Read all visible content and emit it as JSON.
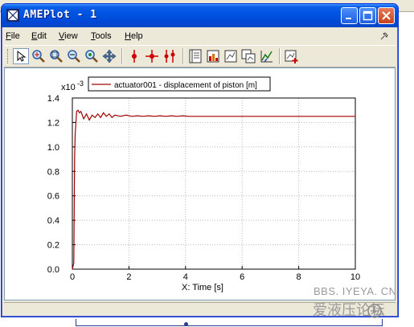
{
  "window": {
    "title": "AMEPlot - 1"
  },
  "menu": [
    {
      "lead": "F",
      "rest": "ile"
    },
    {
      "lead": "E",
      "rest": "dit"
    },
    {
      "lead": "V",
      "rest": "iew"
    },
    {
      "lead": "T",
      "rest": "ools"
    },
    {
      "lead": "H",
      "rest": "elp"
    }
  ],
  "toolbar": {
    "tools": [
      "select-arrow-icon",
      "zoom-area-icon",
      "zoom-in-icon",
      "zoom-out-icon",
      "zoom-fit-icon",
      "pan-icon",
      "cursor-single-icon",
      "cursor-cross-icon",
      "cursor-double-icon",
      "plot-list-icon",
      "color-plot-icon",
      "plot-properties-icon",
      "copy-plot-icon",
      "xy-plot-icon",
      "new-plot-icon"
    ]
  },
  "watermark": {
    "url": "BBS. IYEYA. CN",
    "chinese": "爱液压论坛"
  },
  "chart_data": {
    "type": "line",
    "title": "",
    "xlabel": "X: Time [s]",
    "ylabel": "",
    "y_multiplier": "x10",
    "y_exponent": "-3",
    "xlim": [
      0,
      10
    ],
    "ylim": [
      0,
      1.4
    ],
    "x_ticks": [
      "0",
      "2",
      "4",
      "6",
      "8",
      "10"
    ],
    "y_ticks": [
      "0.0",
      "0.2",
      "0.4",
      "0.6",
      "0.8",
      "1.0",
      "1.2",
      "1.4"
    ],
    "grid": true,
    "legend_position": "top",
    "series": [
      {
        "name": "actuator001 - displacement of piston [m]",
        "color": "#a00000",
        "x": [
          0,
          0.05,
          0.08,
          0.1,
          0.15,
          0.2,
          0.25,
          0.3,
          0.4,
          0.5,
          0.6,
          0.7,
          0.8,
          0.9,
          1.0,
          1.1,
          1.2,
          1.3,
          1.4,
          1.5,
          1.7,
          1.9,
          2.1,
          2.3,
          2.5,
          2.7,
          2.9,
          3.1,
          3.3,
          3.5,
          3.7,
          3.9,
          4.1,
          4.5,
          5,
          6,
          7,
          8,
          9,
          10
        ],
        "y": [
          0,
          0.05,
          0.9,
          1.1,
          1.29,
          1.3,
          1.28,
          1.29,
          1.23,
          1.27,
          1.22,
          1.26,
          1.24,
          1.27,
          1.24,
          1.28,
          1.25,
          1.27,
          1.24,
          1.26,
          1.25,
          1.26,
          1.25,
          1.255,
          1.25,
          1.255,
          1.25,
          1.255,
          1.25,
          1.255,
          1.25,
          1.255,
          1.25,
          1.25,
          1.25,
          1.25,
          1.25,
          1.25,
          1.25,
          1.25
        ]
      }
    ]
  },
  "colors": {
    "titlebar": "#0054e3",
    "window_face": "#ece9d8",
    "series": "#a00000",
    "grid": "#b9b9b9"
  }
}
